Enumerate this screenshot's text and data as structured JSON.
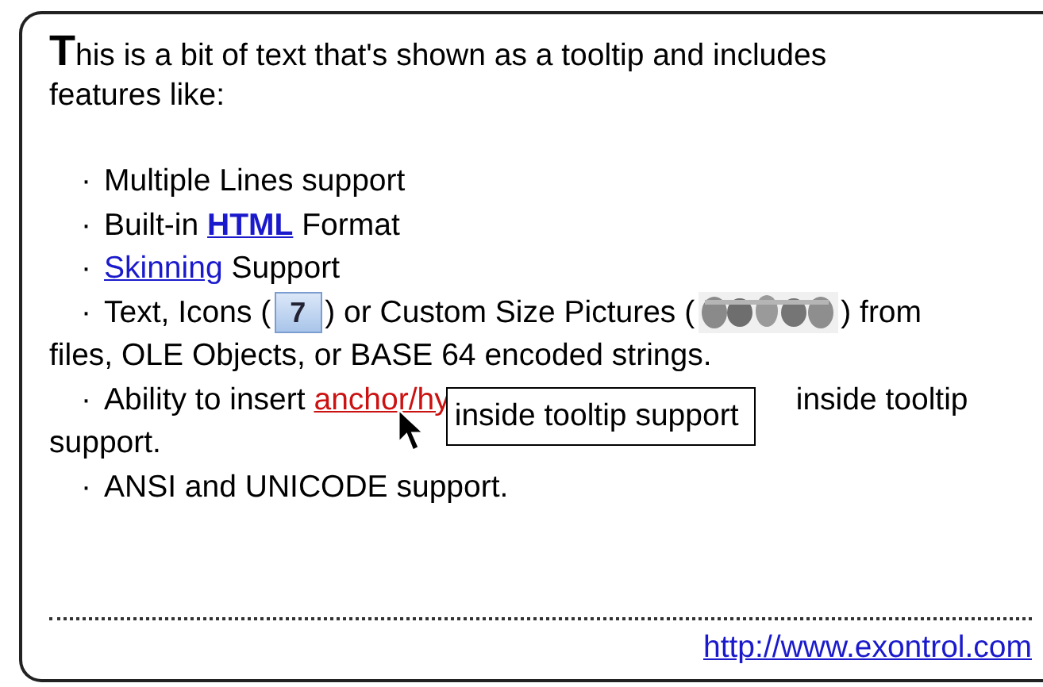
{
  "tooltip": {
    "initial": "T",
    "intro": [
      "his is a bit of text that's shown as a tooltip and includes",
      "features like:"
    ],
    "items": [
      {
        "bullet": "·",
        "parts": [
          {
            "kind": "text",
            "text": "Multiple Lines support"
          }
        ]
      },
      {
        "bullet": "·",
        "parts": [
          {
            "kind": "text",
            "text": "Built-in"
          },
          {
            "kind": "strong-link",
            "text": "HTML"
          },
          {
            "kind": "text",
            "text": "Format"
          }
        ]
      },
      {
        "bullet": "·",
        "parts": [
          {
            "kind": "link",
            "text": "Skinning"
          },
          {
            "kind": "text",
            "text": "Support"
          }
        ]
      },
      {
        "bullet": "·",
        "parts": [
          {
            "kind": "text",
            "text": "Text, Icons ("
          },
          {
            "kind": "icon",
            "text": "7"
          },
          {
            "kind": "text",
            "text": ") or Custom Size Pictures ("
          },
          {
            "kind": "picture"
          },
          {
            "kind": "text",
            "text": ") from"
          },
          {
            "kind": "break"
          },
          {
            "kind": "text",
            "text": "files, OLE Objects, or BASE 64 encoded strings."
          }
        ]
      },
      {
        "bullet": "·",
        "parts": [
          {
            "kind": "text",
            "text": "Ability to insert"
          },
          {
            "kind": "hot-link",
            "text": "anchor/hy"
          },
          {
            "kind": "covered",
            "popup": "inside tooltip support"
          },
          {
            "kind": "text",
            "text": "inside tooltip"
          },
          {
            "kind": "break"
          },
          {
            "kind": "text",
            "text": "support."
          }
        ]
      },
      {
        "bullet": "·",
        "parts": [
          {
            "kind": "text",
            "text": "ANSI and UNICODE support."
          }
        ]
      }
    ],
    "footer_link": "http://www.exontrol.com"
  }
}
